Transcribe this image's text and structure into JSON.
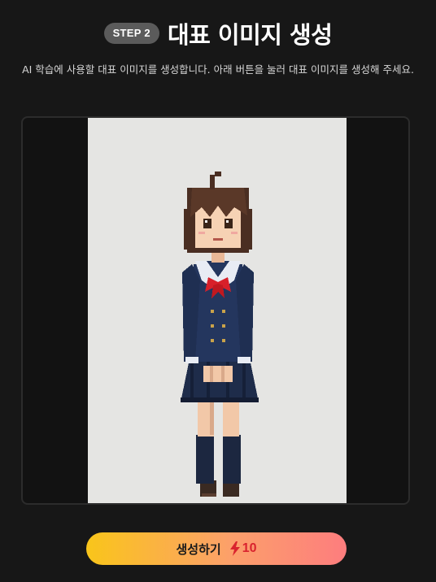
{
  "header": {
    "step_label": "STEP 2",
    "title": "대표 이미지 생성"
  },
  "description": "AI 학습에 사용할 대표 이미지를 생성합니다. 아래 버튼을 눌러 대표 이미지를 생성해 주세요.",
  "preview": {
    "image_subject": "pixel-art character in navy school uniform with red ribbon"
  },
  "generate_button": {
    "label": "생성하기",
    "cost_icon": "lightning-icon",
    "cost": "10"
  },
  "colors": {
    "background": "#171717",
    "button_gradient_start": "#f9c51a",
    "button_gradient_end": "#fd7d7e",
    "cost_color": "#d9232e"
  }
}
